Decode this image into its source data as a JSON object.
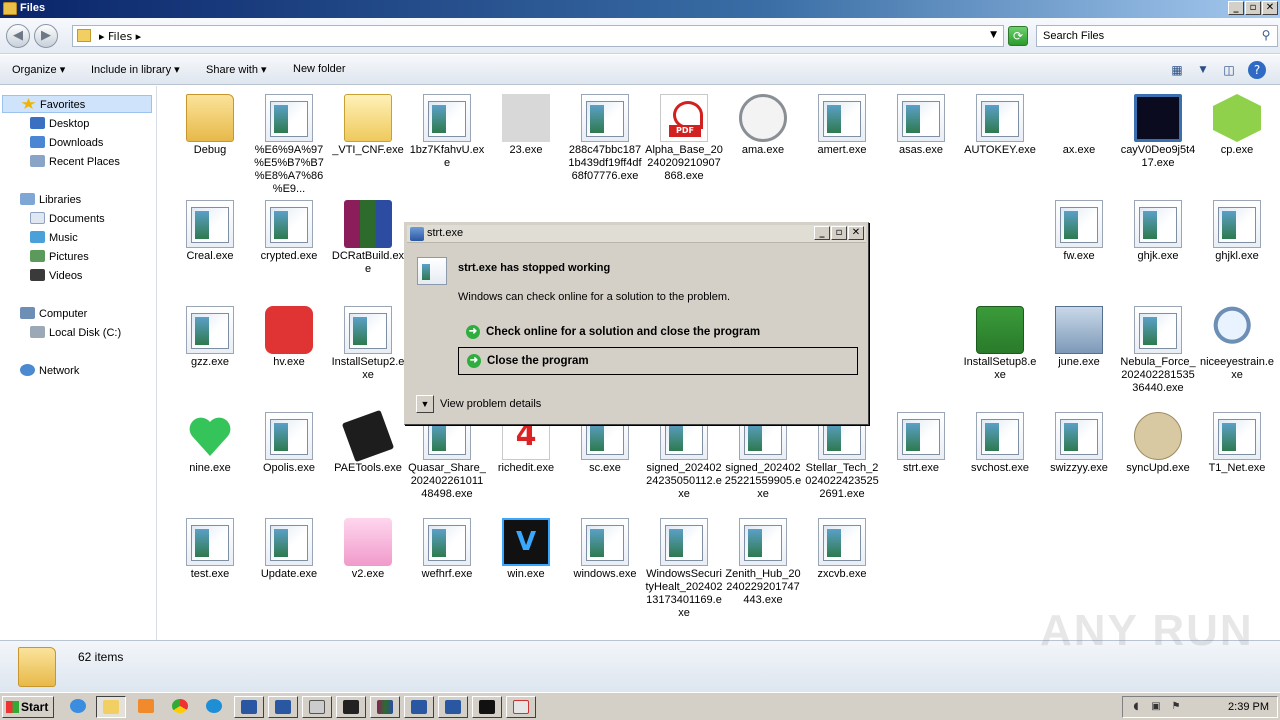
{
  "window": {
    "title": "Files"
  },
  "address": {
    "crumb": "Files",
    "search_placeholder": "Search Files"
  },
  "toolbar": {
    "organize": "Organize",
    "include": "Include in library",
    "share": "Share with",
    "new_folder": "New folder"
  },
  "nav": {
    "favorites": "Favorites",
    "desktop": "Desktop",
    "downloads": "Downloads",
    "recent": "Recent Places",
    "libraries": "Libraries",
    "documents": "Documents",
    "music": "Music",
    "pictures": "Pictures",
    "videos": "Videos",
    "computer": "Computer",
    "local_disk": "Local Disk (C:)",
    "network": "Network"
  },
  "files": [
    {
      "name": "Debug",
      "icon": "folder"
    },
    {
      "name": "%E6%9A%97%E5%B7%B7%E8%A7%86%E9...",
      "icon": "exe"
    },
    {
      "name": "_VTI_CNF.exe",
      "icon": "folder2"
    },
    {
      "name": "1bz7KfahvU.exe",
      "icon": "exe"
    },
    {
      "name": "23.exe",
      "icon": "blank"
    },
    {
      "name": "288c47bbc1871b439df19ff4df68f07776.exe",
      "icon": "exe"
    },
    {
      "name": "Alpha_Base_20240209210907868.exe",
      "icon": "pdf"
    },
    {
      "name": "ama.exe",
      "icon": "gauge"
    },
    {
      "name": "amert.exe",
      "icon": "exe"
    },
    {
      "name": "asas.exe",
      "icon": "exe"
    },
    {
      "name": "AUTOKEY.exe",
      "icon": "exe"
    },
    {
      "name": "ax.exe",
      "icon": "none"
    },
    {
      "name": "cayV0Deo9j5t417.exe",
      "icon": "monitor"
    },
    {
      "name": "cp.exe",
      "icon": "green-cube"
    },
    {
      "name": "Creal.exe",
      "icon": "exe"
    },
    {
      "name": "crypted.exe",
      "icon": "exe"
    },
    {
      "name": "DCRatBuild.exe",
      "icon": "rar"
    },
    {
      "name": "fw.exe",
      "icon": "exe"
    },
    {
      "name": "ghjk.exe",
      "icon": "exe"
    },
    {
      "name": "ghjkl.exe",
      "icon": "exe"
    },
    {
      "name": "gzz.exe",
      "icon": "exe"
    },
    {
      "name": "hv.exe",
      "icon": "red"
    },
    {
      "name": "InstallSetup2.exe",
      "icon": "exe"
    },
    {
      "name": "InstallSetup8.exe",
      "icon": "amazon"
    },
    {
      "name": "june.exe",
      "icon": "setup"
    },
    {
      "name": "Nebula_Force_20240228153536440.exe",
      "icon": "exe"
    },
    {
      "name": "niceeyestrain.exe",
      "icon": "magnify"
    },
    {
      "name": "nine.exe",
      "icon": "heart"
    },
    {
      "name": "Opolis.exe",
      "icon": "exe"
    },
    {
      "name": "PAETools.exe",
      "icon": "chip"
    },
    {
      "name": "Quasar_Share_20240226101148498.exe",
      "icon": "exe"
    },
    {
      "name": "richedit.exe",
      "icon": "four"
    },
    {
      "name": "sc.exe",
      "icon": "exe"
    },
    {
      "name": "signed_20240224235050112.exe",
      "icon": "exe"
    },
    {
      "name": "signed_20240225221559905.exe",
      "icon": "exe"
    },
    {
      "name": "Stellar_Tech_20240224235252691.exe",
      "icon": "exe"
    },
    {
      "name": "strt.exe",
      "icon": "exe"
    },
    {
      "name": "svchost.exe",
      "icon": "exe"
    },
    {
      "name": "swizzyy.exe",
      "icon": "exe"
    },
    {
      "name": "syncUpd.exe",
      "icon": "bubble"
    },
    {
      "name": "T1_Net.exe",
      "icon": "exe"
    },
    {
      "name": "test.exe",
      "icon": "exe"
    },
    {
      "name": "Update.exe",
      "icon": "exe"
    },
    {
      "name": "v2.exe",
      "icon": "pink"
    },
    {
      "name": "wefhrf.exe",
      "icon": "exe"
    },
    {
      "name": "win.exe",
      "icon": "v"
    },
    {
      "name": "windows.exe",
      "icon": "exe"
    },
    {
      "name": "WindowsSecurityHealt_20240213173401169.exe",
      "icon": "exe"
    },
    {
      "name": "Zenith_Hub_20240229201747443.exe",
      "icon": "exe"
    },
    {
      "name": "zxcvb.exe",
      "icon": "exe"
    }
  ],
  "status": {
    "count": "62 items"
  },
  "dialog": {
    "title": "strt.exe",
    "heading": "strt.exe has stopped working",
    "sub": "Windows can check online for a solution to the problem.",
    "opt1": "Check online for a solution and close the program",
    "opt2": "Close the program",
    "details": "View problem details"
  },
  "taskbar": {
    "start": "Start",
    "clock": "2:39 PM"
  },
  "watermark": "ANY RUN"
}
